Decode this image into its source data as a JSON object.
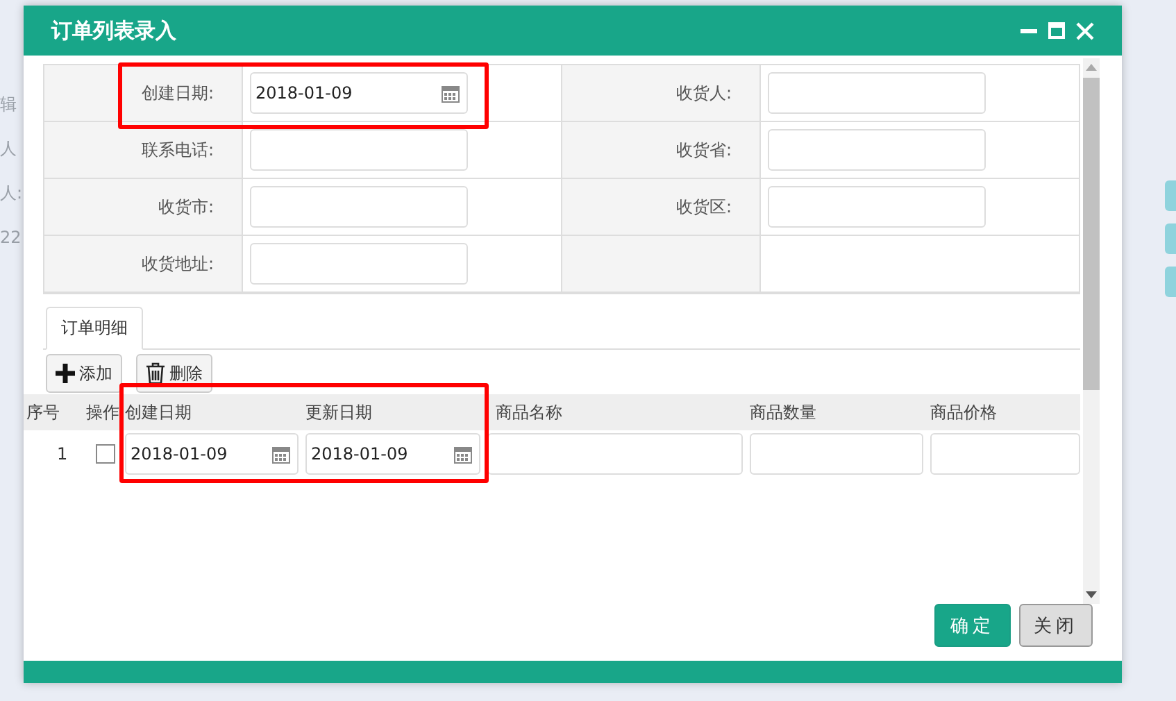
{
  "window": {
    "title": "订单列表录入"
  },
  "form": {
    "rows": [
      [
        {
          "label": "创建日期:",
          "kind": "date",
          "value": "2018-01-09"
        },
        {
          "label": "收货人:",
          "kind": "text"
        }
      ],
      [
        {
          "label": "联系电话:",
          "kind": "text"
        },
        {
          "label": "收货省:",
          "kind": "text"
        }
      ],
      [
        {
          "label": "收货市:",
          "kind": "text"
        },
        {
          "label": "收货区:",
          "kind": "text"
        }
      ],
      [
        {
          "label": "收货地址:",
          "kind": "text"
        }
      ]
    ]
  },
  "tabs": [
    {
      "label": "订单明细",
      "selected": true
    }
  ],
  "toolbar": [
    {
      "label": "添加",
      "kind": "add"
    },
    {
      "label": "删除",
      "kind": "delete"
    }
  ],
  "grid": {
    "columns": [
      "序号",
      "操作",
      "创建日期",
      "更新日期",
      "商品名称",
      "商品数量",
      "商品价格"
    ],
    "rows": [
      {
        "cells": [
          {
            "kind": "index",
            "value": "1"
          },
          {
            "kind": "check",
            "checked": false
          },
          {
            "kind": "date",
            "value": "2018-01-09"
          },
          {
            "kind": "date",
            "value": "2018-01-09"
          },
          {
            "kind": "text"
          },
          {
            "kind": "text"
          },
          {
            "kind": "text"
          }
        ]
      }
    ]
  },
  "buttons": [
    {
      "label": "确定",
      "kind": "primary"
    },
    {
      "label": "关闭",
      "kind": "default"
    }
  ],
  "background": {
    "left_texts": [
      "辑",
      "人",
      "人:",
      "22"
    ]
  }
}
